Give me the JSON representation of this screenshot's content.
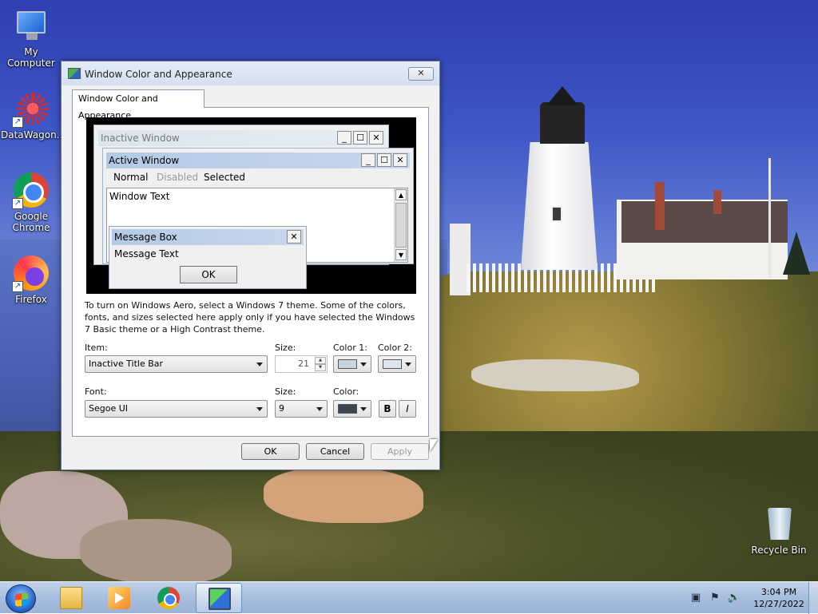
{
  "desktop": {
    "icons": [
      {
        "label": "My Computer",
        "icon": "computer-icon"
      },
      {
        "label": "DataWagon...",
        "icon": "datawagon-icon"
      },
      {
        "label": "Google Chrome",
        "icon": "chrome-icon"
      },
      {
        "label": "Firefox",
        "icon": "firefox-icon"
      },
      {
        "label": "Recycle Bin",
        "icon": "recycle-bin-icon"
      }
    ]
  },
  "dialog": {
    "title": "Window Color and Appearance",
    "close_glyph": "✕",
    "tab_label": "Window Color and Appearance",
    "preview": {
      "inactive_window_title": "Inactive Window",
      "active_window_title": "Active Window",
      "menu_normal": "Normal",
      "menu_disabled": "Disabled",
      "menu_selected": "Selected",
      "window_text": "Window Text",
      "message_box_title": "Message Box",
      "message_text": "Message Text",
      "ok_label": "OK"
    },
    "info_text": "To turn on Windows Aero, select a Windows 7 theme.  Some of the colors, fonts, and sizes selected here apply only if you have selected the Windows 7 Basic theme or a High Contrast theme.",
    "item": {
      "label": "Item:",
      "value": "Inactive Title Bar",
      "size_label": "Size:",
      "size_value": "21",
      "color1_label": "Color 1:",
      "color2_label": "Color 2:",
      "color1": "#c8d4e2",
      "color2": "#dde5ef"
    },
    "font": {
      "label": "Font:",
      "value": "Segoe UI",
      "size_label": "Size:",
      "size_value": "9",
      "color_label": "Color:",
      "color": "#3d4650",
      "bold_label": "B",
      "italic_label": "I"
    },
    "buttons": {
      "ok": "OK",
      "cancel": "Cancel",
      "apply": "Apply"
    }
  },
  "taskbar": {
    "pinned": [
      "windows-explorer-icon",
      "media-player-icon",
      "chrome-icon",
      "display-settings-icon"
    ],
    "clock_time": "3:04 PM",
    "clock_date": "12/27/2022"
  }
}
